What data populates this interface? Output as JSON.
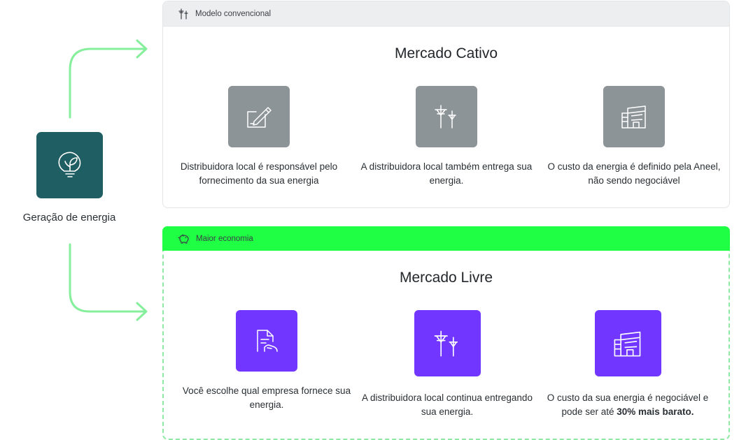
{
  "generation": {
    "label": "Geração de energia",
    "icon": "bulb-leaf-icon",
    "color": "#1f5e63"
  },
  "connector_color": "#86ef9b",
  "captive_market": {
    "badge": "Modelo convencional",
    "badge_icon": "power-tower-icon",
    "title": "Mercado Cativo",
    "tile_color": "#8d9498",
    "items": [
      {
        "icon": "contract-sign-icon",
        "text": "Distribuidora local é responsável pelo fornecimento da sua energia"
      },
      {
        "icon": "power-lines-icon",
        "text": "A distribuidora local também entrega sua energia."
      },
      {
        "icon": "building-icon",
        "text": "O custo da energia é definido pela Aneel, não sendo negociável"
      }
    ]
  },
  "free_market": {
    "badge": "Maior economia",
    "badge_icon": "piggy-bank-icon",
    "badge_color": "#1fff43",
    "title": "Mercado Livre",
    "tile_color": "#7136ff",
    "items": [
      {
        "icon": "document-hand-icon",
        "text": "Você escolhe qual empresa fornece sua energia."
      },
      {
        "icon": "power-lines-icon",
        "text": "A distribuidora local continua entregando sua energia."
      },
      {
        "icon": "building-icon",
        "text_prefix": "O custo da sua energia é negociável e pode ser até ",
        "text_bold": "30% mais barato."
      }
    ]
  }
}
